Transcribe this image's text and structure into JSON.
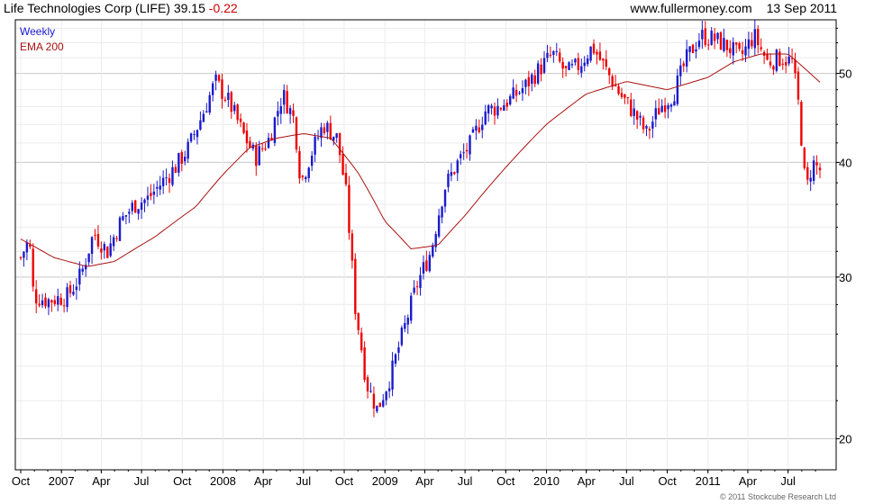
{
  "header": {
    "title": "Life Technologies Corp (LIFE)",
    "price": "39.15",
    "change": "-0.22",
    "site": "www.fullermoney.com",
    "date": "13 Sep 2011"
  },
  "legend": {
    "weekly": "Weekly",
    "ema": "EMA 200"
  },
  "footer": {
    "copyright": "© 2011 Stockcube Research Ltd"
  },
  "colors": {
    "up": "#1a1acc",
    "down": "#ee0000",
    "ema": "#aa1111",
    "grid": "#d9d9d9",
    "frame": "#000000"
  },
  "chart_data": {
    "type": "candlestick",
    "frequency": "weekly",
    "ylim": [
      18.5,
      57.2
    ],
    "y_ticks": [
      20,
      30,
      40,
      50
    ],
    "grid": true,
    "log_scale": true,
    "x_labels": [
      "Oct",
      "2007",
      "Apr",
      "Jul",
      "Oct",
      "2008",
      "Apr",
      "Jul",
      "Oct",
      "2009",
      "Apr",
      "Jul",
      "Oct",
      "2010",
      "Apr",
      "Jul",
      "Oct",
      "2011",
      "Apr",
      "Jul"
    ],
    "x_start": "2006-10-01",
    "x_end": "2011-09-13",
    "price_series": [
      [
        "2006-10-01",
        31.5
      ],
      [
        "2006-10-20",
        33.0
      ],
      [
        "2006-10-30",
        28.6
      ],
      [
        "2006-12-01",
        28.3
      ],
      [
        "2007-01-15",
        28.6
      ],
      [
        "2007-02-15",
        30.2
      ],
      [
        "2007-03-15",
        33.5
      ],
      [
        "2007-04-15",
        32.0
      ],
      [
        "2007-05-15",
        34.5
      ],
      [
        "2007-06-15",
        36.0
      ],
      [
        "2007-07-15",
        36.5
      ],
      [
        "2007-08-15",
        38.0
      ],
      [
        "2007-09-15",
        39.5
      ],
      [
        "2007-10-15",
        41.5
      ],
      [
        "2007-11-15",
        45.0
      ],
      [
        "2007-12-15",
        49.0
      ],
      [
        "2008-01-15",
        46.5
      ],
      [
        "2008-02-15",
        43.0
      ],
      [
        "2008-03-15",
        40.5
      ],
      [
        "2008-04-15",
        42.5
      ],
      [
        "2008-05-15",
        47.5
      ],
      [
        "2008-06-10",
        44.5
      ],
      [
        "2008-06-25",
        38.0
      ],
      [
        "2008-07-15",
        40.5
      ],
      [
        "2008-08-15",
        44.0
      ],
      [
        "2008-09-15",
        42.5
      ],
      [
        "2008-10-05",
        37.0
      ],
      [
        "2008-10-25",
        28.0
      ],
      [
        "2008-11-20",
        23.0
      ],
      [
        "2008-12-15",
        21.5
      ],
      [
        "2009-01-15",
        23.5
      ],
      [
        "2009-02-15",
        26.5
      ],
      [
        "2009-03-15",
        29.5
      ],
      [
        "2009-04-15",
        32.0
      ],
      [
        "2009-05-15",
        37.5
      ],
      [
        "2009-06-15",
        40.0
      ],
      [
        "2009-07-15",
        42.0
      ],
      [
        "2009-08-15",
        45.5
      ],
      [
        "2009-09-15",
        46.0
      ],
      [
        "2009-10-15",
        47.0
      ],
      [
        "2009-11-15",
        48.5
      ],
      [
        "2009-12-15",
        50.5
      ],
      [
        "2010-01-15",
        52.5
      ],
      [
        "2010-02-15",
        50.0
      ],
      [
        "2010-03-15",
        51.0
      ],
      [
        "2010-04-15",
        53.5
      ],
      [
        "2010-05-15",
        50.5
      ],
      [
        "2010-06-15",
        47.5
      ],
      [
        "2010-07-15",
        45.5
      ],
      [
        "2010-08-15",
        43.0
      ],
      [
        "2010-09-15",
        46.0
      ],
      [
        "2010-10-15",
        47.5
      ],
      [
        "2010-11-15",
        52.0
      ],
      [
        "2010-12-15",
        55.0
      ],
      [
        "2011-01-15",
        54.5
      ],
      [
        "2011-02-15",
        53.5
      ],
      [
        "2011-03-15",
        52.0
      ],
      [
        "2011-04-15",
        55.0
      ],
      [
        "2011-05-15",
        51.5
      ],
      [
        "2011-06-15",
        52.0
      ],
      [
        "2011-07-10",
        51.5
      ],
      [
        "2011-07-25",
        46.0
      ],
      [
        "2011-08-10",
        37.0
      ],
      [
        "2011-08-25",
        40.0
      ],
      [
        "2011-09-13",
        39.15
      ]
    ],
    "ema_series": [
      [
        "2006-10-01",
        33.0
      ],
      [
        "2006-12-15",
        31.5
      ],
      [
        "2007-03-01",
        30.8
      ],
      [
        "2007-05-01",
        31.2
      ],
      [
        "2007-08-01",
        33.2
      ],
      [
        "2007-11-01",
        35.8
      ],
      [
        "2008-01-01",
        38.8
      ],
      [
        "2008-03-01",
        41.5
      ],
      [
        "2008-05-01",
        42.5
      ],
      [
        "2008-07-01",
        43.0
      ],
      [
        "2008-09-01",
        42.5
      ],
      [
        "2008-11-01",
        39.0
      ],
      [
        "2009-01-01",
        34.5
      ],
      [
        "2009-03-01",
        32.2
      ],
      [
        "2009-05-01",
        32.5
      ],
      [
        "2009-07-01",
        35.0
      ],
      [
        "2009-10-01",
        39.5
      ],
      [
        "2010-01-01",
        44.0
      ],
      [
        "2010-04-01",
        47.5
      ],
      [
        "2010-07-01",
        49.0
      ],
      [
        "2010-10-01",
        48.0
      ],
      [
        "2011-01-01",
        49.5
      ],
      [
        "2011-03-01",
        51.5
      ],
      [
        "2011-05-01",
        52.5
      ],
      [
        "2011-07-01",
        52.5
      ],
      [
        "2011-09-13",
        48.8
      ]
    ]
  }
}
